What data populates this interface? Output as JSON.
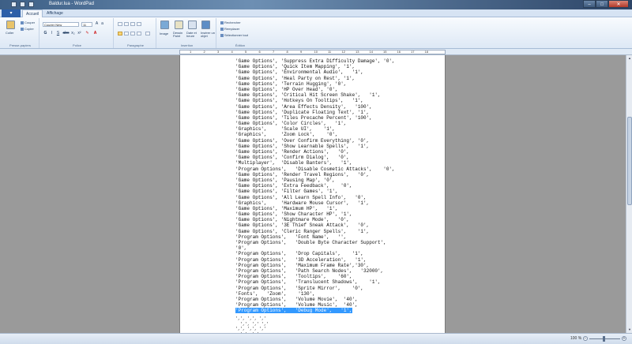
{
  "window": {
    "title": "Baldur.lua - WordPad",
    "controls": {
      "minimize": "–",
      "maximize": "□",
      "close": "✕"
    }
  },
  "ribbon": {
    "tabs": [
      "Accueil",
      "Affichage"
    ],
    "active_tab": "Accueil",
    "clipboard": {
      "label": "Presse-papiers",
      "paste": "Coller",
      "cut": "Couper",
      "copy": "Copier"
    },
    "font": {
      "label": "Police",
      "family": "Courier New",
      "size": "11",
      "buttons": [
        "G",
        "I",
        "S",
        "abc",
        "x₂",
        "x²"
      ]
    },
    "paragraph": {
      "label": "Paragraphe"
    },
    "insertion": {
      "label": "Insertion",
      "items": [
        "Image",
        "Dessin Paint",
        "Date et heure",
        "Insérer un objet"
      ]
    },
    "edit": {
      "label": "Édition",
      "find": "Rechercher",
      "replace": "Remplacer",
      "select_all": "Sélectionner tout"
    }
  },
  "ruler": {
    "numbers": [
      "1",
      "2",
      "3",
      "4",
      "5",
      "6",
      "7",
      "8",
      "9",
      "10",
      "11",
      "12",
      "13",
      "14",
      "15",
      "16",
      "17",
      "18"
    ]
  },
  "document": {
    "lines": [
      "'Game Options', 'Suppress Extra Difficulty Damage', '0',",
      "'Game Options', 'Quick Item Mapping', '1',",
      "'Game Options', 'Environmental Audio',   '1',",
      "'Game Options', 'Heal Party on Rest', '1',",
      "'Game Options', 'Terrain Hugging', '0',",
      "'Game Options', 'HP Over Head', '0',",
      "'Game Options', 'Critical Hit Screen Shake',   '1',",
      "'Game Options', 'Hotkeys On Tooltips',   '1',",
      "'Game Options', 'Area Effects Density',   '100',",
      "'Game Options', 'Duplicate Floating Text', '1',",
      "'Game Options', 'Tiles Precache Percent', '100',",
      "'Game Options', 'Color Circles',   '1',",
      "'Graphics',     'Scale UI',    '1',",
      "'Graphics',     'Zoom Lock',    '0',",
      "'Game Options', 'Over Confirm Everything', '0',",
      "'Game Options', 'Show Learnable Spells',   '1',",
      "'Game Options', 'Render Actions',   '0',",
      "'Game Options', 'Confirm Dialog',   '0',",
      "'Multiplayer',  'Disable Banters',   '1',",
      "'Program Options',   'Disable Cosmetic Attacks',    '0',",
      "'Game Options', 'Render Travel Regions',   '0',",
      "'Game Options', 'Pausing Map', '0',",
      "'Game Options', 'Extra Feedback',    '0',",
      "'Game Options', 'Filter Games', '1',",
      "'Game Options', 'All Learn Spell Info',   '0',",
      "'Graphics',     'Hardware Mouse Cursor',   '1',",
      "'Game Options', 'Maximum HP',   '1',",
      "'Game Options', 'Show Character HP', '1',",
      "'Game Options', 'Nightmare Mode',   '0',",
      "'Game Options', '3E Thief Sneak Attack',   '0',",
      "'Game Options', 'Cleric Ranger Spells',    '1',",
      "'Program Options',   'Font Name',   '',",
      "'Program Options',   'Double Byte Character Support',",
      "'0',",
      "'Program Options',   'Drop Capitals',    '1',",
      "'Program Options',   '3D Acceleration',   '1',",
      "'Program Options',   'Maximum Frame Rate','30',",
      "'Program Options',   'Path Search Nodes',   '32000',",
      "'Program Options',   'Tooltips',    '60',",
      "'Program Options',   'Translucent Shadows',    '1',",
      "'Program Options',   'Sprite Mirror',    '0',",
      "'Fonts',   'Zoom',    '130',",
      "'Program Options',   'Volume Movie',  '40',",
      "'Program Options',   'Volume Music',  '40',",
      "'Program Options',   'Debug Mode',   '1',"
    ],
    "selected_line_index": 44,
    "trailing_fragments": [
      "',', ',', ','",
      "  ',', ',' ','",
      "',', ',', ','",
      "  ',', ','"
    ]
  },
  "statusbar": {
    "zoom": "100 %",
    "zoom_minus": "−",
    "zoom_plus": "+"
  }
}
